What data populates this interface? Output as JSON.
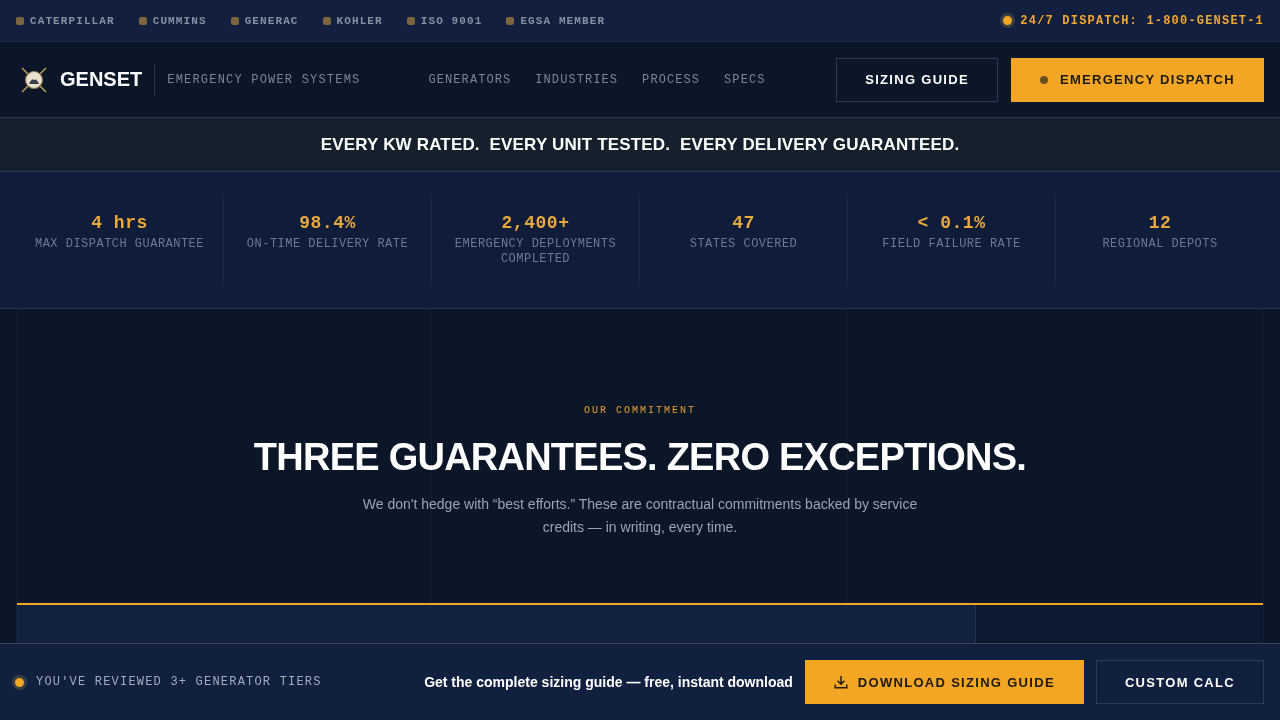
{
  "top_bar": {
    "partners": [
      "CATERPILLAR",
      "CUMMINS",
      "GENERAC",
      "KOHLER",
      "ISO 9001",
      "EGSA MEMBER"
    ],
    "dispatch": "24/7 DISPATCH: 1-800-GENSET-1"
  },
  "header": {
    "brand": "GENSET",
    "tagline": "EMERGENCY POWER SYSTEMS",
    "nav": [
      "GENERATORS",
      "INDUSTRIES",
      "PROCESS",
      "SPECS"
    ],
    "buttons": [
      {
        "label": "SIZING GUIDE",
        "kind": "outline"
      },
      {
        "label": "EMERGENCY DISPATCH",
        "kind": "primary"
      }
    ]
  },
  "banner": "EVERY KW RATED.  EVERY UNIT TESTED.  EVERY DELIVERY GUARANTEED.",
  "stats": [
    {
      "value": "4 hrs",
      "label": "MAX DISPATCH GUARANTEE"
    },
    {
      "value": "98.4%",
      "label": "ON-TIME DELIVERY RATE"
    },
    {
      "value": "2,400+",
      "label": "EMERGENCY DEPLOYMENTS COMPLETED"
    },
    {
      "value": "47",
      "label": "STATES COVERED"
    },
    {
      "value": "< 0.1%",
      "label": "FIELD FAILURE RATE"
    },
    {
      "value": "12",
      "label": "REGIONAL DEPOTS"
    }
  ],
  "commitment": {
    "eyebrow": "OUR COMMITMENT",
    "title": "THREE GUARANTEES. ZERO EXCEPTIONS.",
    "text": "We don't hedge with “best efforts.” These are contractual commitments backed by service credits — in writing, every time."
  },
  "sticky_bar": {
    "note": "YOU'VE REVIEWED 3+ GENERATOR TIERS",
    "prompt": "Get the complete sizing guide — free, instant download",
    "buttons": [
      {
        "label": "DOWNLOAD SIZING GUIDE",
        "kind": "primary"
      },
      {
        "label": "CUSTOM CALC",
        "kind": "outline"
      }
    ]
  }
}
